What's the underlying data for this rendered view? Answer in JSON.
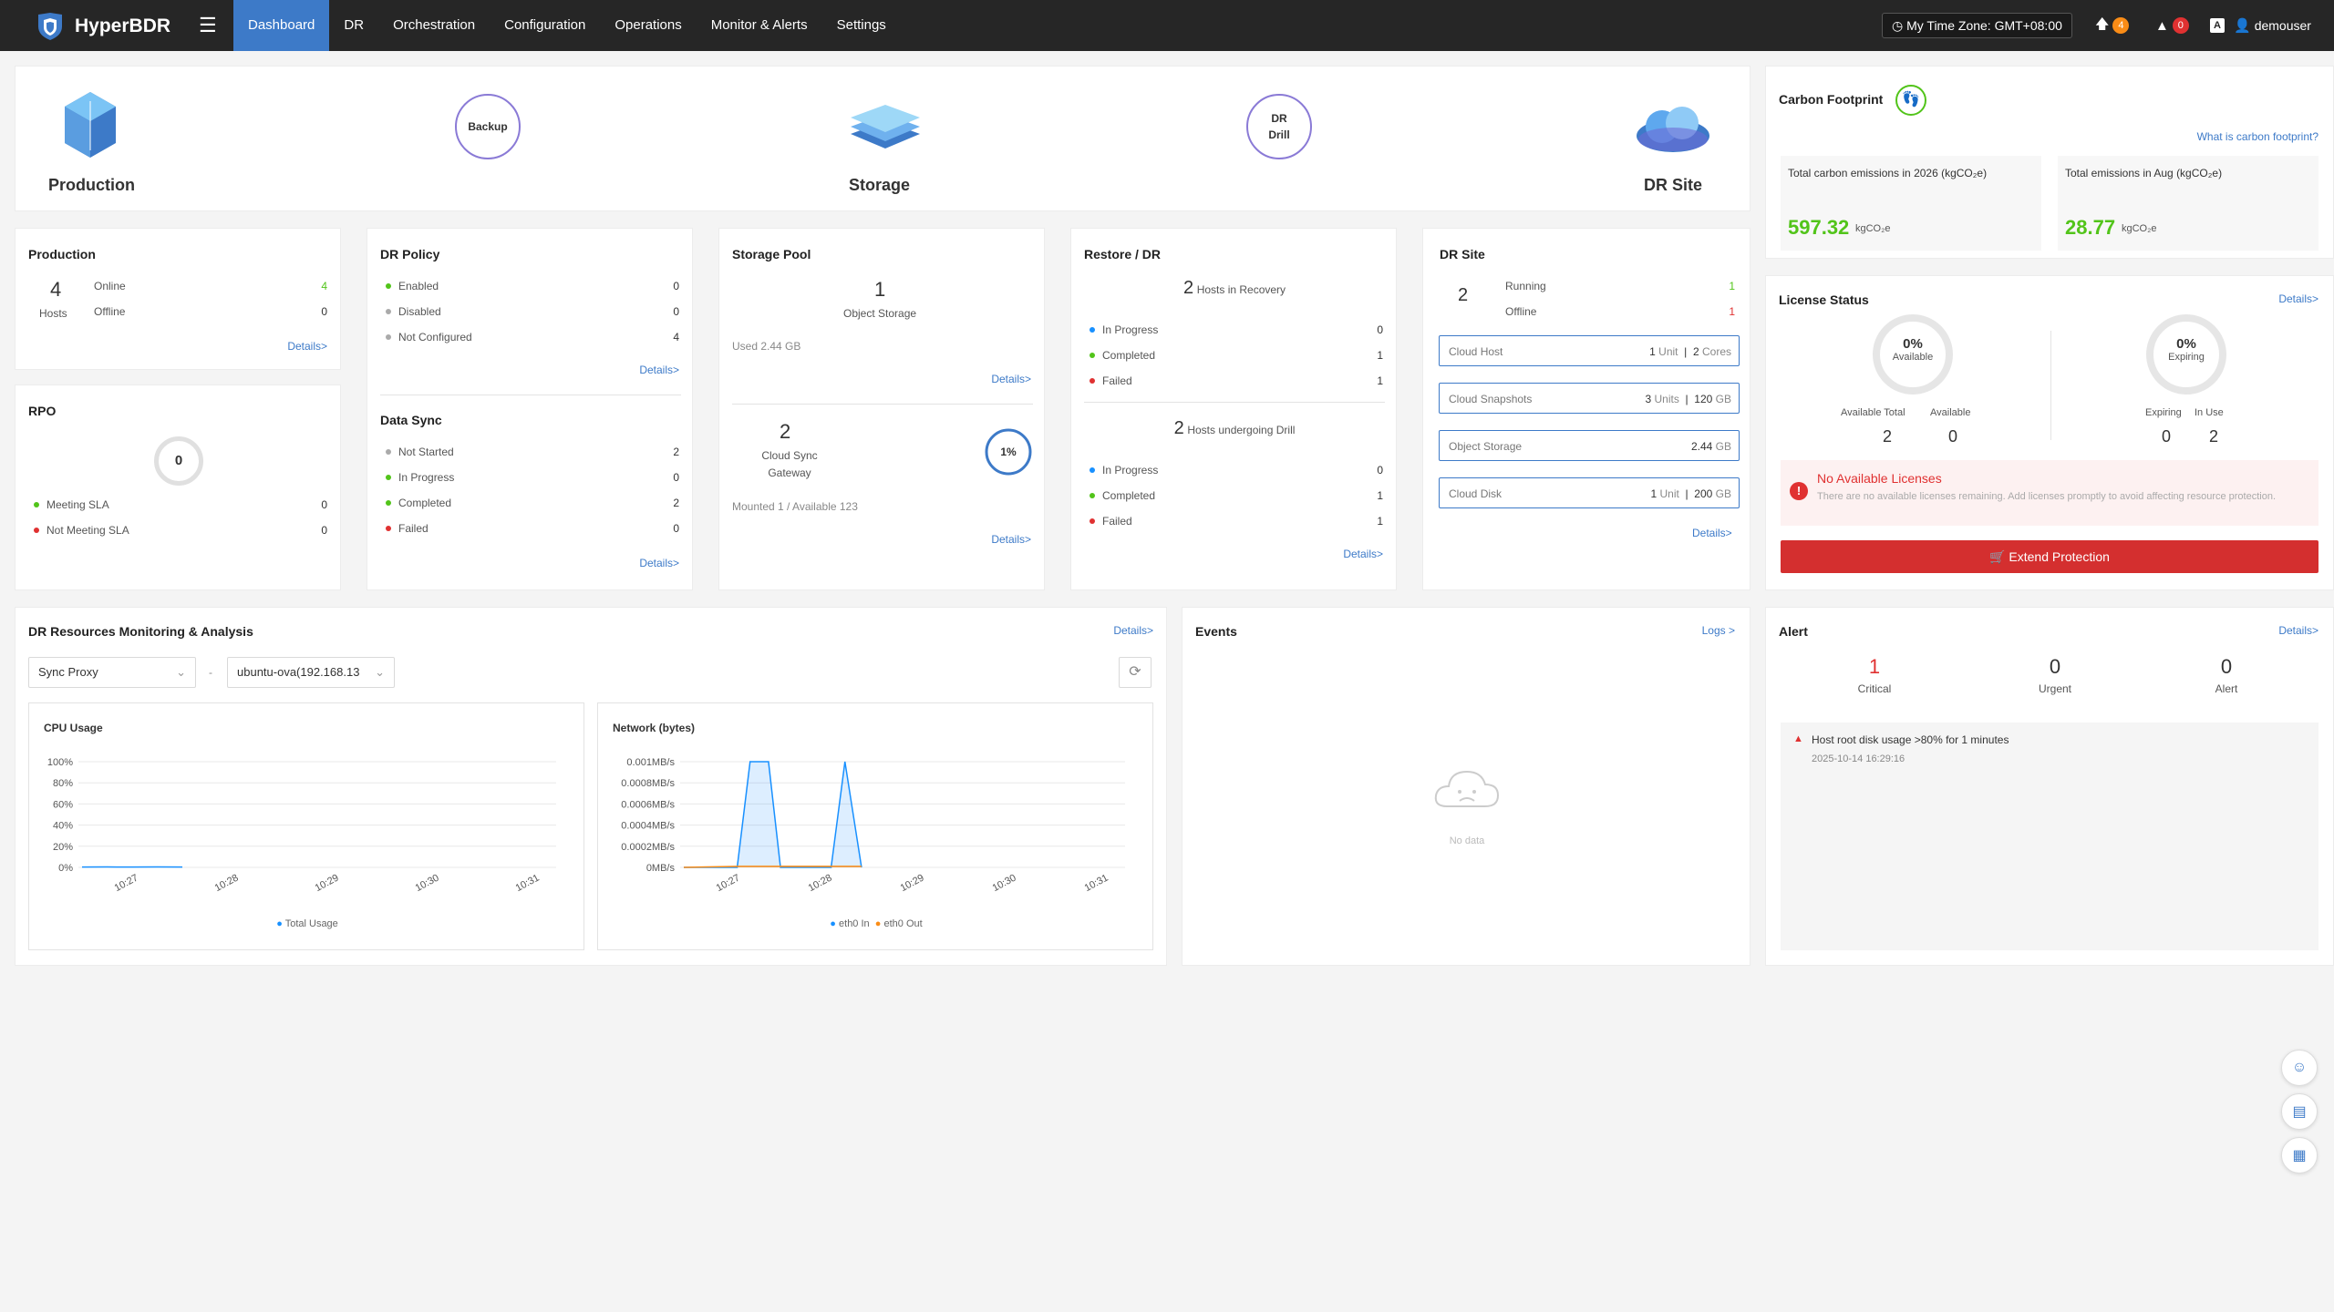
{
  "app": {
    "name": "HyperBDR"
  },
  "nav": {
    "items": [
      "Dashboard",
      "DR",
      "Orchestration",
      "Configuration",
      "Operations",
      "Monitor & Alerts",
      "Settings"
    ],
    "active": "Dashboard"
  },
  "topbar": {
    "timezone": "My Time Zone: GMT+08:00",
    "upload_count": "4",
    "alert_count": "0",
    "user": "demouser"
  },
  "flow": {
    "production": "Production",
    "backup": "Backup",
    "storage": "Storage",
    "dr_drill": "DR\nDrill",
    "dr_site": "DR Site"
  },
  "production": {
    "title": "Production",
    "hosts": "4",
    "hosts_label": "Hosts",
    "online_label": "Online",
    "online": "4",
    "offline_label": "Offline",
    "offline": "0",
    "details": "Details>"
  },
  "rpo": {
    "title": "RPO",
    "value": "0",
    "meeting_label": "Meeting SLA",
    "meeting": "0",
    "not_meeting_label": "Not Meeting SLA",
    "not_meeting": "0"
  },
  "dr_policy": {
    "title": "DR Policy",
    "enabled_label": "Enabled",
    "enabled": "0",
    "disabled_label": "Disabled",
    "disabled": "0",
    "not_configured_label": "Not Configured",
    "not_configured": "4",
    "details": "Details>"
  },
  "data_sync": {
    "title": "Data Sync",
    "not_started_label": "Not Started",
    "not_started": "2",
    "in_progress_label": "In Progress",
    "in_progress": "0",
    "completed_label": "Completed",
    "completed": "2",
    "failed_label": "Failed",
    "failed": "0",
    "details": "Details>"
  },
  "storage_pool": {
    "title": "Storage Pool",
    "count": "1",
    "count_label": "Object Storage",
    "used": "Used 2.44 GB",
    "details": "Details>",
    "gateway_count": "2",
    "gateway_label": "Cloud Sync\nGateway",
    "percent": "1%",
    "percent_value": 1,
    "mounted": "Mounted 1 / Available 123",
    "details2": "Details>"
  },
  "restore": {
    "title": "Restore / DR",
    "recovery_count": "2",
    "recovery_label": "Hosts in Recovery",
    "r_in_progress_label": "In Progress",
    "r_in_progress": "0",
    "r_completed_label": "Completed",
    "r_completed": "1",
    "r_failed_label": "Failed",
    "r_failed": "1",
    "drill_count": "2",
    "drill_label": "Hosts undergoing Drill",
    "d_in_progress_label": "In Progress",
    "d_in_progress": "0",
    "d_completed_label": "Completed",
    "d_completed": "1",
    "d_failed_label": "Failed",
    "d_failed": "1",
    "details": "Details>"
  },
  "dr_site": {
    "title": "DR Site",
    "count": "2",
    "running_label": "Running",
    "running": "1",
    "offline_label": "Offline",
    "offline": "1",
    "cloud_host_label": "Cloud Host",
    "cloud_host_units": "1",
    "cloud_host_unit_label": "Unit",
    "cloud_host_cores": "2",
    "cloud_host_cores_label": "Cores",
    "snapshots_label": "Cloud Snapshots",
    "snapshots_units": "3",
    "snapshots_unit_label": "Units",
    "snapshots_size": "120",
    "snapshots_size_unit": "GB",
    "object_label": "Object Storage",
    "object_size": "2.44",
    "object_unit": "GB",
    "disk_label": "Cloud Disk",
    "disk_units": "1",
    "disk_unit_label": "Unit",
    "disk_size": "200",
    "disk_size_unit": "GB",
    "details": "Details>"
  },
  "carbon": {
    "title": "Carbon Footprint",
    "link": "What is carbon footprint?",
    "total_label": "Total carbon emissions in 2026 (kgCO₂e)",
    "total_value": "597.32",
    "total_unit": "kgCO₂e",
    "month_label": "Total emissions in Aug (kgCO₂e)",
    "month_value": "28.77",
    "month_unit": "kgCO₂e"
  },
  "license": {
    "title": "License Status",
    "details": "Details>",
    "available_pct": "0%",
    "available_word": "Available",
    "available_total_label": "Available Total",
    "available_total": "2",
    "available_label": "Available",
    "available": "0",
    "expiring_pct": "0%",
    "expiring_word": "Expiring",
    "expiring_label": "Expiring",
    "expiring": "0",
    "in_use_label": "In Use",
    "in_use": "2",
    "warn_title": "No Available Licenses",
    "warn_text": "There are no available licenses remaining. Add licenses promptly to avoid affecting resource protection.",
    "button": "Extend Protection"
  },
  "monitor": {
    "title": "DR Resources Monitoring & Analysis",
    "details": "Details>",
    "select1": "Sync Proxy",
    "sep": "-",
    "select2": "ubuntu-ova(192.168.13"
  },
  "events": {
    "title": "Events",
    "logs": "Logs >",
    "empty": "No data"
  },
  "alert": {
    "title": "Alert",
    "details": "Details>",
    "critical": "1",
    "critical_label": "Critical",
    "urgent": "0",
    "urgent_label": "Urgent",
    "alert": "0",
    "alert_label": "Alert",
    "item_text": "Host root disk usage >80% for 1 minutes",
    "item_time": "2025-10-14 16:29:16"
  },
  "colors": {
    "accent": "#3d7ac8",
    "green": "#52c41a",
    "red": "#e03131",
    "orange": "#fa8c16",
    "bar": "#262626"
  },
  "chart_data": [
    {
      "type": "line",
      "title": "CPU Usage",
      "x": [
        "10:27",
        "10:28",
        "10:29",
        "10:30",
        "10:31"
      ],
      "y_ticks": [
        "100%",
        "80%",
        "60%",
        "40%",
        "20%",
        "0%"
      ],
      "ylim": [
        0,
        100
      ],
      "series": [
        {
          "name": "Total Usage",
          "color": "#1890ff",
          "points": [
            [
              0,
              0.3
            ],
            [
              0.25,
              0.4
            ],
            [
              0.5,
              0.3
            ],
            [
              0.75,
              0.4
            ],
            [
              1,
              0.3
            ]
          ]
        }
      ]
    },
    {
      "type": "area",
      "title": "Network (bytes)",
      "x": [
        "10:27",
        "10:28",
        "10:29",
        "10:30",
        "10:31"
      ],
      "y_ticks": [
        "0.001MB/s",
        "0.0008MB/s",
        "0.0006MB/s",
        "0.0004MB/s",
        "0.0002MB/s",
        "0MB/s"
      ],
      "ylim": [
        0,
        0.001
      ],
      "series": [
        {
          "name": "eth0 In",
          "color": "#1890ff",
          "points": [
            [
              0,
              0
            ],
            [
              0.58,
              0
            ],
            [
              0.72,
              0.001
            ],
            [
              0.92,
              0.001
            ],
            [
              1.05,
              0
            ],
            [
              1.6,
              0
            ],
            [
              1.75,
              0.001
            ],
            [
              1.93,
              0
            ]
          ]
        },
        {
          "name": "eth0 Out",
          "color": "#fa8c16",
          "points": [
            [
              0,
              0
            ],
            [
              0.6,
              1e-05
            ],
            [
              1.0,
              1e-05
            ],
            [
              1.6,
              1e-05
            ],
            [
              1.93,
              1e-05
            ]
          ]
        }
      ]
    }
  ]
}
